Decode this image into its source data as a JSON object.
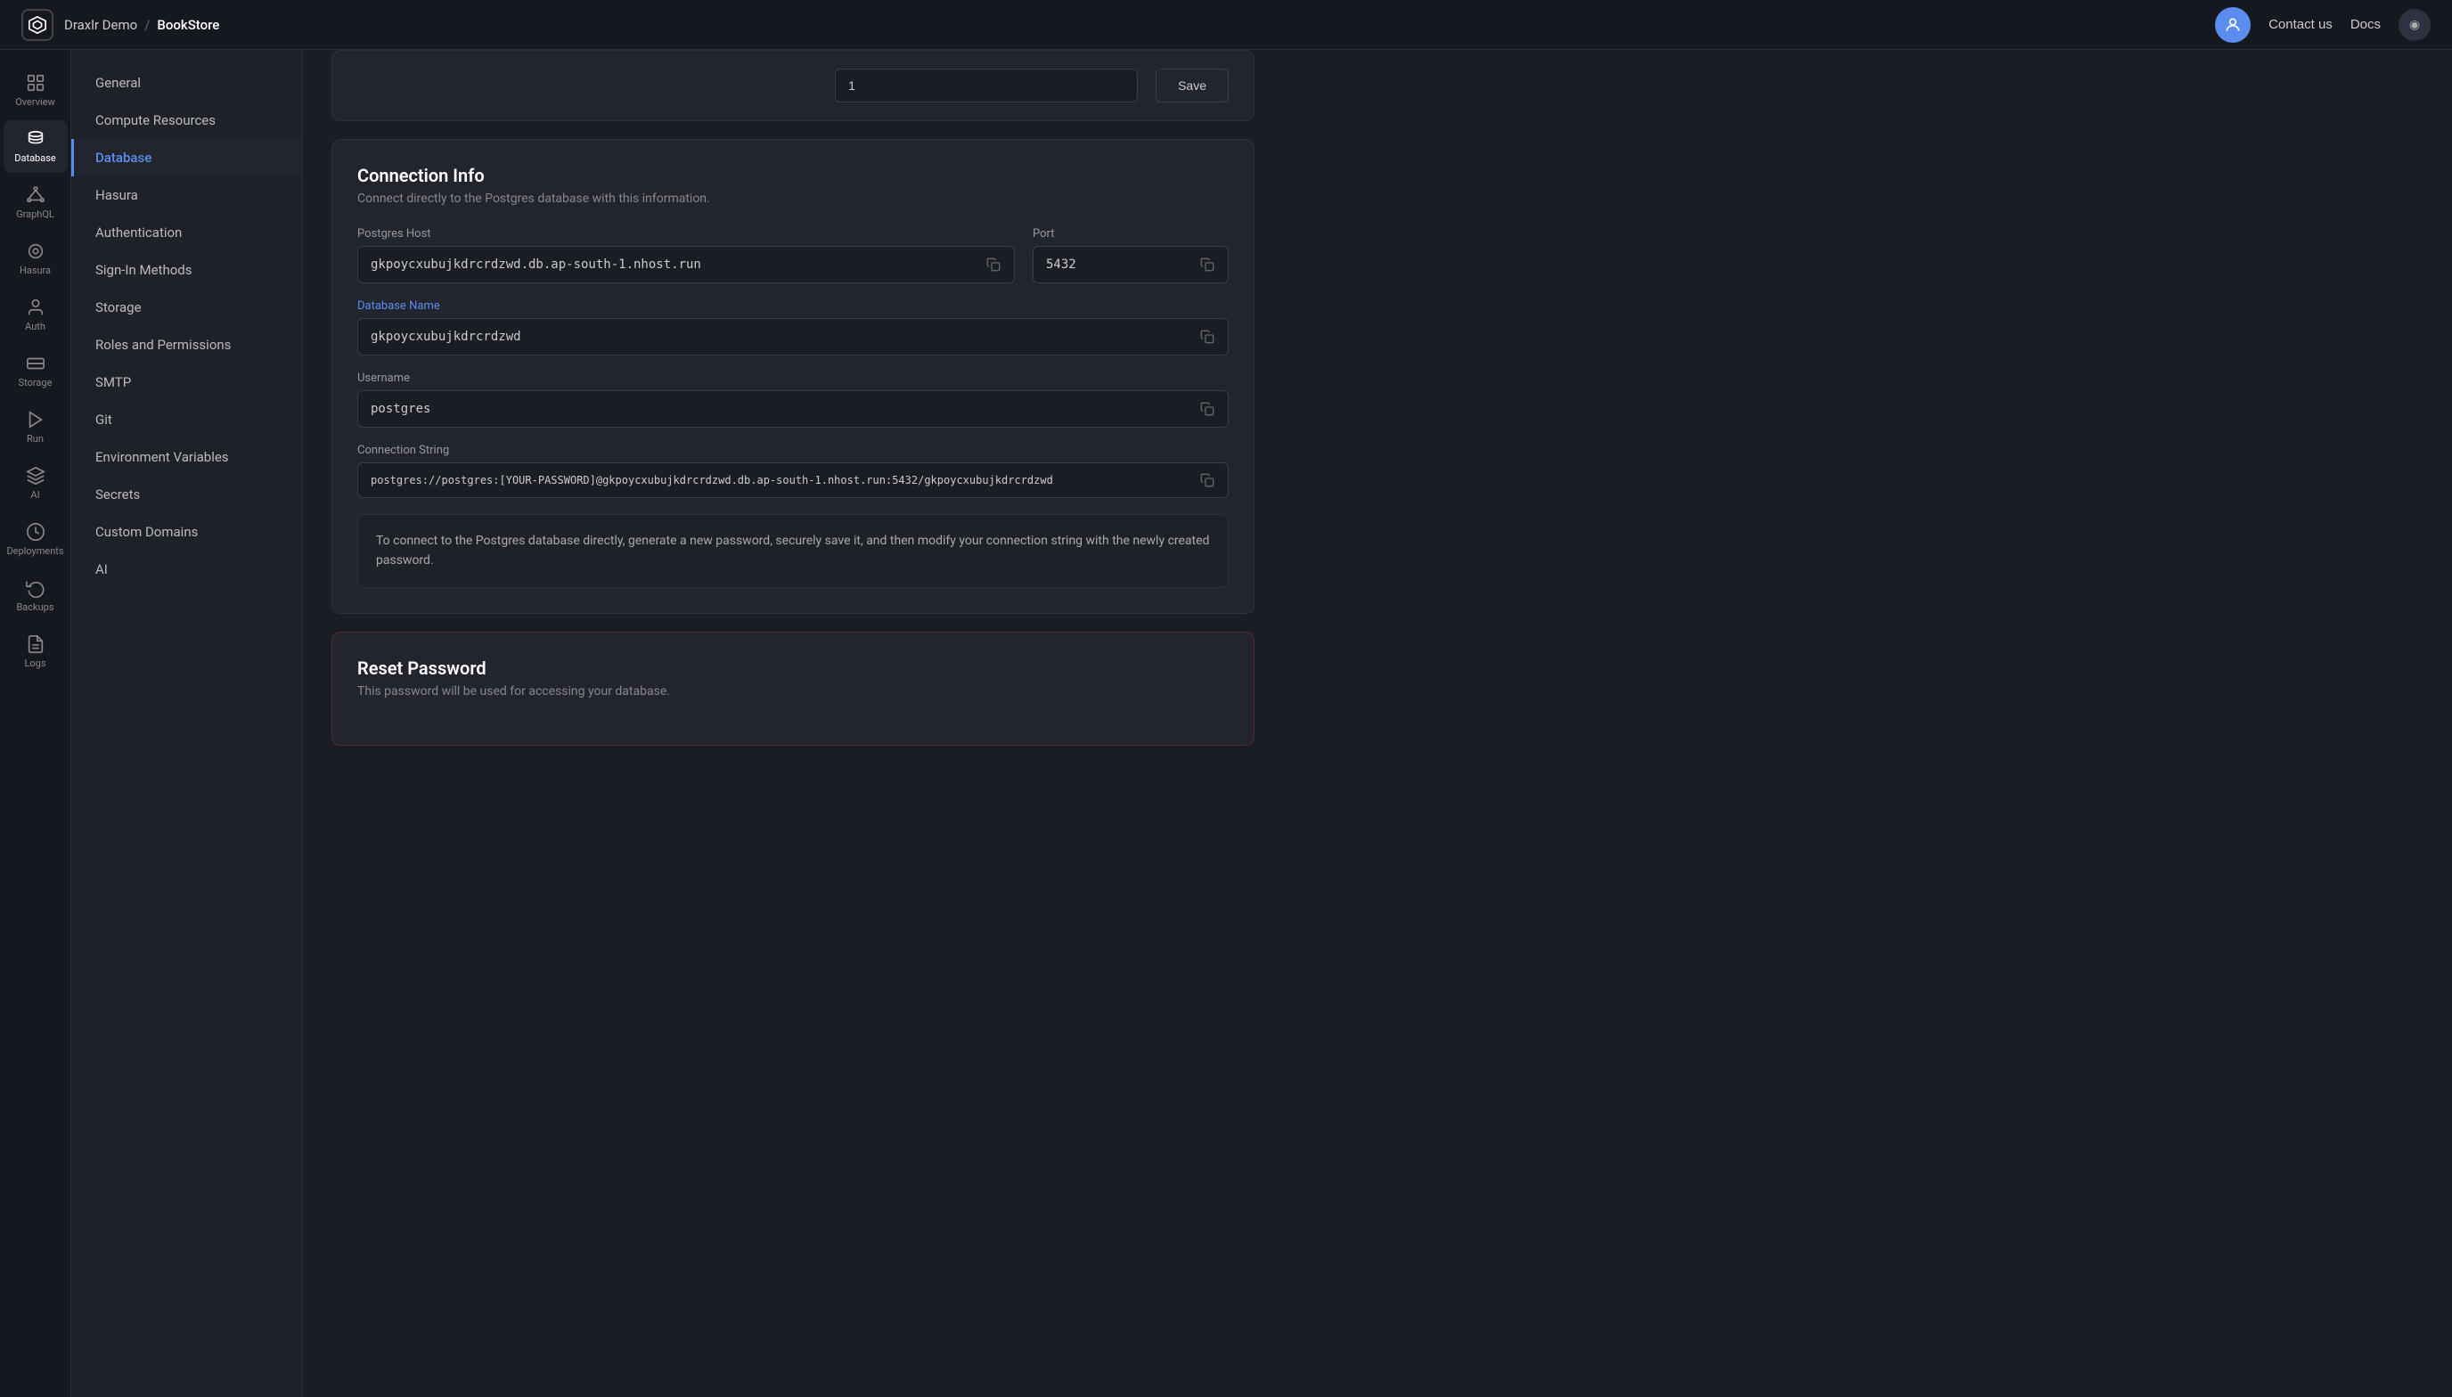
{
  "topbar": {
    "logo_symbol": "⬡",
    "breadcrumb": [
      "Draxlr Demo",
      "BookStore"
    ],
    "breadcrumb_sep": "/",
    "contact_label": "Contact us",
    "docs_label": "Docs",
    "avatar_symbol": "◉"
  },
  "icon_nav": [
    {
      "id": "overview",
      "label": "Overview",
      "icon": "overview"
    },
    {
      "id": "database",
      "label": "Database",
      "icon": "database",
      "active": true
    },
    {
      "id": "graphql",
      "label": "GraphQL",
      "icon": "graphql"
    },
    {
      "id": "hasura",
      "label": "Hasura",
      "icon": "hasura"
    },
    {
      "id": "auth",
      "label": "Auth",
      "icon": "auth"
    },
    {
      "id": "storage",
      "label": "Storage",
      "icon": "storage"
    },
    {
      "id": "run",
      "label": "Run",
      "icon": "run"
    },
    {
      "id": "ai",
      "label": "AI",
      "icon": "ai"
    },
    {
      "id": "deployments",
      "label": "Deployments",
      "icon": "deployments"
    },
    {
      "id": "backups",
      "label": "Backups",
      "icon": "backups"
    },
    {
      "id": "logs",
      "label": "Logs",
      "icon": "logs"
    }
  ],
  "sidebar": {
    "items": [
      {
        "id": "general",
        "label": "General"
      },
      {
        "id": "compute",
        "label": "Compute Resources"
      },
      {
        "id": "database",
        "label": "Database",
        "active": true
      },
      {
        "id": "hasura",
        "label": "Hasura"
      },
      {
        "id": "authentication",
        "label": "Authentication"
      },
      {
        "id": "signin",
        "label": "Sign-In Methods"
      },
      {
        "id": "storage",
        "label": "Storage"
      },
      {
        "id": "roles",
        "label": "Roles and Permissions"
      },
      {
        "id": "smtp",
        "label": "SMTP"
      },
      {
        "id": "git",
        "label": "Git"
      },
      {
        "id": "envvars",
        "label": "Environment Variables"
      },
      {
        "id": "secrets",
        "label": "Secrets"
      },
      {
        "id": "domains",
        "label": "Custom Domains"
      },
      {
        "id": "ai",
        "label": "AI"
      }
    ]
  },
  "top_partial": {
    "input_value": "1",
    "save_label": "Save"
  },
  "connection_info": {
    "title": "Connection Info",
    "description": "Connect directly to the Postgres database with this information.",
    "postgres_host_label": "Postgres Host",
    "postgres_host_value": "gkpoycxubujkdrcrdzwd.db.ap-south-1.nhost.run",
    "port_label": "Port",
    "port_value": "5432",
    "db_name_label": "Database Name",
    "db_name_value": "gkpoycxubujkdrcrdzwd",
    "username_label": "Username",
    "username_value": "postgres",
    "connection_string_label": "Connection String",
    "connection_string_value": "postgres://postgres:[YOUR-PASSWORD]@gkpoycxubujkdrcrdzwd.db.ap-south-1.nhost.run:5432/gkpoycxubujkdrcrdzwd",
    "info_text": "To connect to the Postgres database directly, generate a new password, securely save it, and then modify your connection string with the newly created password."
  },
  "reset_password": {
    "title": "Reset Password",
    "description": "This password will be used for accessing your database."
  }
}
